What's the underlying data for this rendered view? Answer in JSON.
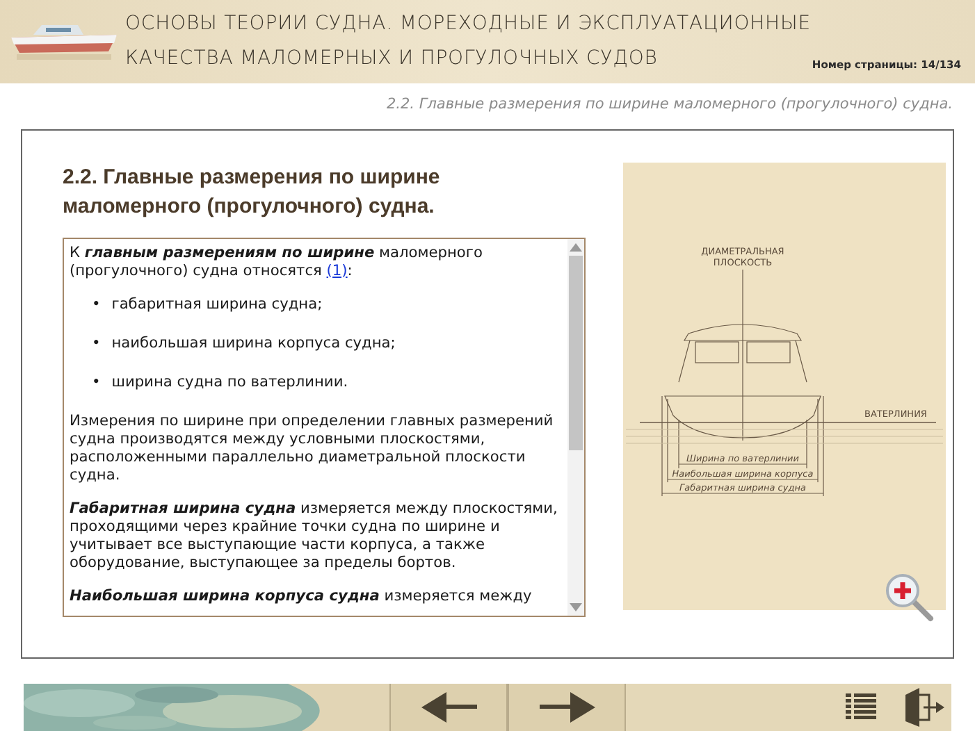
{
  "header": {
    "title_lines": [
      "ОСНОВЫ ТЕОРИИ СУДНА. МОРЕХОДНЫЕ И ЭКСПЛУАТАЦИОННЫЕ",
      "КАЧЕСТВА МАЛОМЕРНЫХ И ПРОГУЛОЧНЫХ СУДОВ"
    ],
    "page_number": "Номер страницы: 14/134"
  },
  "breadcrumb": "2.2. Главные размерения по ширине маломерного (прогулочного) судна.",
  "content": {
    "heading": "2.2. Главные размерения по ширине маломерного (прогулочного) судна.",
    "blocks": [
      {
        "kind": "intro",
        "text": "К **главным размерениям по ширине** маломерного (прогулочного) судна относятся",
        "link": "(1)",
        "tail": ":"
      },
      {
        "kind": "list",
        "marker": "•",
        "items": [
          "габаритная ширина судна;",
          "наибольшая ширина корпуса судна;",
          "ширина судна по ватерлинии."
        ]
      },
      {
        "kind": "paragraph",
        "text": "Измерения по ширине при определении главных размерений судна производятся между условными плоскостями, расположенными параллельно диаметральной плоскости судна."
      },
      {
        "kind": "paragraph",
        "text": "**Габаритная ширина судна**  измеряется между плоскостями, проходящими через крайние точки судна по ширине и учитывает все выступающие части корпуса, а также оборудование, выступающее за пределы бортов."
      },
      {
        "kind": "paragraph",
        "text": "**Наибольшая ширина корпуса судна** измеряется между"
      }
    ]
  },
  "figure": {
    "labels": {
      "plane_line1": "ДИАМЕТРАЛЬНАЯ",
      "plane_line2": "ПЛОСКОСТЬ",
      "waterline": "ВАТЕРЛИНИЯ",
      "dim_waterline": "Ширина по ватерлинии",
      "dim_hull": "Наибольшая ширина корпуса",
      "dim_overall": "Габаритная ширина судна"
    }
  }
}
